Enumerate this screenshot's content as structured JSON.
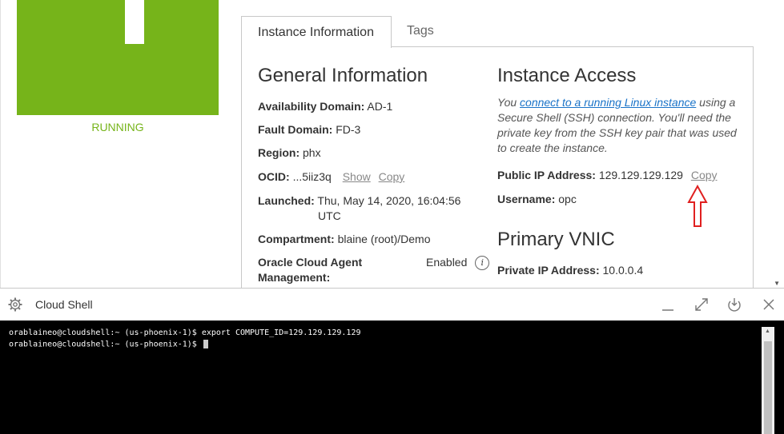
{
  "instance": {
    "status": "RUNNING"
  },
  "tabs": [
    {
      "label": "Instance Information"
    },
    {
      "label": "Tags"
    }
  ],
  "general": {
    "title": "General Information",
    "availability_domain": {
      "label": "Availability Domain:",
      "value": "AD-1"
    },
    "fault_domain": {
      "label": "Fault Domain:",
      "value": "FD-3"
    },
    "region": {
      "label": "Region:",
      "value": "phx"
    },
    "ocid": {
      "label": "OCID:",
      "value": "...5iiz3q",
      "show": "Show",
      "copy": "Copy"
    },
    "launched": {
      "label": "Launched:",
      "value_line1": "Thu, May 14, 2020, 16:04:56",
      "value_line2": "UTC"
    },
    "compartment": {
      "label": "Compartment:",
      "value": "blaine (root)/Demo"
    },
    "agent": {
      "label_line1": "Oracle Cloud Agent",
      "label_line2": "Management:",
      "value": "Enabled"
    }
  },
  "access": {
    "title": "Instance Access",
    "desc_prefix": "You ",
    "desc_link": "connect to a running Linux instance",
    "desc_l1_suffix": " using a",
    "desc_l2": "Secure Shell (SSH) connection. You'll need the",
    "desc_l3": "private key from the SSH key pair that was used",
    "desc_l4": "to create the instance.",
    "public_ip": {
      "label": "Public IP Address:",
      "value": "129.129.129.129",
      "copy": "Copy"
    },
    "username": {
      "label": "Username:",
      "value": "opc"
    }
  },
  "vnic": {
    "title": "Primary VNIC",
    "private_ip": {
      "label": "Private IP Address:",
      "value": "10.0.0.4"
    }
  },
  "shell": {
    "title": "Cloud Shell",
    "lines": [
      "orablaineo@cloudshell:~ (us-phoenix-1)$ export COMPUTE_ID=129.129.129.129",
      "orablaineo@cloudshell:~ (us-phoenix-1)$ "
    ]
  },
  "colors": {
    "running": "#76b41a",
    "annotation_arrow": "#e02020",
    "link": "#1a73c8"
  },
  "icons": [
    "gear-icon",
    "minimize-icon",
    "maximize-icon",
    "restore-icon",
    "close-icon",
    "info-icon",
    "red-arrow-annotation"
  ]
}
